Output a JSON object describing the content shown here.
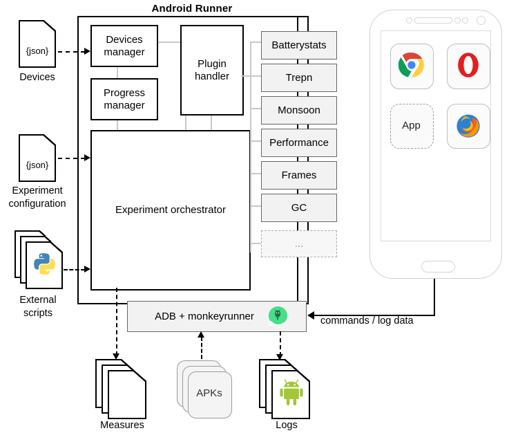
{
  "diagram": {
    "title": "Android Runner",
    "inputs": [
      {
        "label": "Devices",
        "doc_text": "{json}",
        "icon": "json-document-icon"
      },
      {
        "label": "Experiment configuration",
        "doc_text": "{json}",
        "icon": "json-document-icon"
      },
      {
        "label": "External scripts",
        "doc_text": "",
        "icon": "python-logo-icon"
      }
    ],
    "modules": [
      {
        "id": "devices-manager",
        "label": "Devices manager"
      },
      {
        "id": "progress-manager",
        "label": "Progress manager"
      },
      {
        "id": "plugin-handler",
        "label": "Plugin handler"
      },
      {
        "id": "experiment-orchestrator",
        "label": "Experiment orchestrator"
      }
    ],
    "plugins": [
      {
        "label": "Batterystats",
        "style": "solid"
      },
      {
        "label": "Trepn",
        "style": "solid"
      },
      {
        "label": "Monsoon",
        "style": "solid"
      },
      {
        "label": "Performance",
        "style": "solid"
      },
      {
        "label": "Frames",
        "style": "solid"
      },
      {
        "label": "GC",
        "style": "solid"
      },
      {
        "label": "...",
        "style": "dashed"
      }
    ],
    "bridge": {
      "label": "ADB + monkeyrunner",
      "icon": "android-studio-icon"
    },
    "outputs": [
      {
        "id": "measures",
        "label": "Measures",
        "icon": "document-stack-icon"
      },
      {
        "id": "apks",
        "label": "",
        "inner_label": "APKs",
        "icon": "apk-stack-icon"
      },
      {
        "id": "logs",
        "label": "Logs",
        "icon": "android-robot-icon"
      }
    ],
    "edge_label": "commands / log data",
    "device": {
      "name": "android-phone",
      "apps": [
        {
          "label": "",
          "icon": "chrome-icon"
        },
        {
          "label": "",
          "icon": "opera-icon"
        },
        {
          "label": "App",
          "icon": "placeholder-app-icon"
        },
        {
          "label": "",
          "icon": "firefox-icon"
        }
      ]
    },
    "colors": {
      "plugin_fill": "#f2f2f2",
      "plugin_border": "#666666",
      "bridge_fill": "#f2f2f2",
      "connector_grey": "#c9c9c9",
      "stroke": "#000000"
    }
  }
}
